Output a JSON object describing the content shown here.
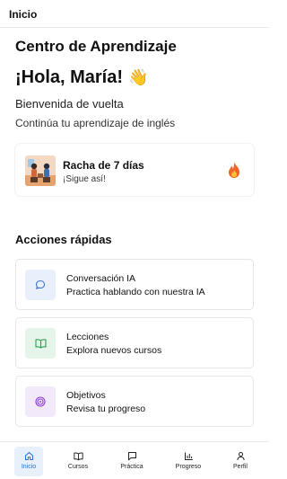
{
  "header": {
    "title": "Inicio"
  },
  "page": {
    "heading": "Centro de Aprendizaje",
    "greeting": "¡Hola, María!",
    "greeting_emoji": "👋",
    "welcome": "Bienvenida de vuelta",
    "subtitle": "Continúa tu aprendizaje de inglés"
  },
  "streak": {
    "title": "Racha de 7 días",
    "subtitle": "¡Sigue así!",
    "icon": "flame-icon"
  },
  "quick_actions": {
    "title": "Acciones rápidas",
    "items": [
      {
        "title": "Conversación IA",
        "subtitle": "Practica hablando con nuestra IA",
        "icon": "chat-bubble-icon",
        "icon_bg": "#e9f0fb",
        "icon_color": "#3b6fd1"
      },
      {
        "title": "Lecciones",
        "subtitle": "Explora nuevos cursos",
        "icon": "book-icon",
        "icon_bg": "#e6f5ea",
        "icon_color": "#2f9a4e"
      },
      {
        "title": "Objetivos",
        "subtitle": "Revisa tu progreso",
        "icon": "target-icon",
        "icon_bg": "#f2e9fb",
        "icon_color": "#8a3fd0"
      }
    ]
  },
  "bottom_nav": {
    "items": [
      {
        "label": "Inicio",
        "icon": "home-icon",
        "active": true
      },
      {
        "label": "Cursos",
        "icon": "book-icon",
        "active": false
      },
      {
        "label": "Práctica",
        "icon": "chat-icon",
        "active": false
      },
      {
        "label": "Progreso",
        "icon": "bar-chart-icon",
        "active": false
      },
      {
        "label": "Perfil",
        "icon": "user-icon",
        "active": false
      }
    ]
  },
  "colors": {
    "accent": "#2a6fd6",
    "active_nav_bg": "#e8f0fb",
    "border": "#e3e6ea"
  }
}
